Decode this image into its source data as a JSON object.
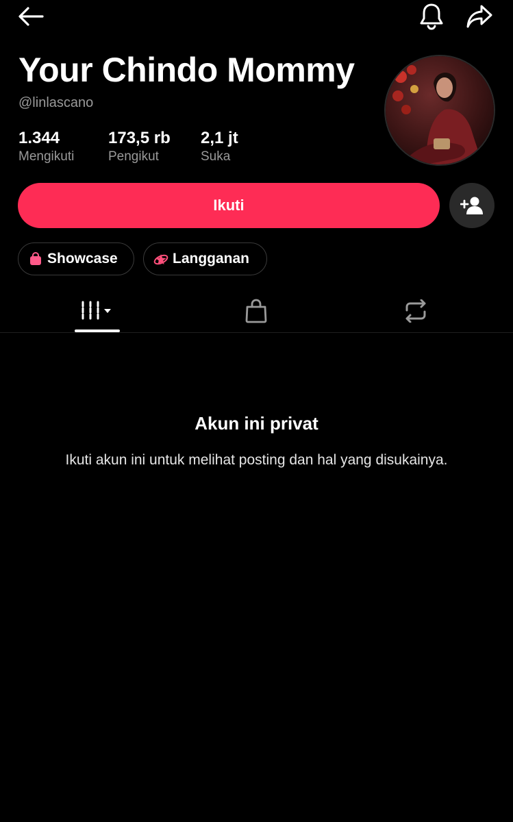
{
  "header": {
    "back_icon": "arrow-left-icon",
    "notification_icon": "bell-icon",
    "share_icon": "share-arrow-icon"
  },
  "profile": {
    "display_name": "Your Chindo Mommy",
    "username": "@linlascano",
    "stats": [
      {
        "value": "1.344",
        "label": "Mengikuti"
      },
      {
        "value": "173,5 rb",
        "label": "Pengikut"
      },
      {
        "value": "2,1 jt",
        "label": "Suka"
      }
    ]
  },
  "actions": {
    "follow_label": "Ikuti",
    "add_friend_icon": "person-add-icon",
    "follow_color": "#fe2c55"
  },
  "chips": [
    {
      "label": "Showcase",
      "icon": "shopping-bag-icon",
      "icon_color": "#ff5a8a"
    },
    {
      "label": "Langganan",
      "icon": "subscription-star-icon",
      "icon_color": "#ff4f7b"
    }
  ],
  "tabs": [
    {
      "icon": "videos-grid-dropdown-icon",
      "active": true
    },
    {
      "icon": "shopping-bag-outline-icon",
      "active": false
    },
    {
      "icon": "repost-icon",
      "active": false
    }
  ],
  "private_notice": {
    "title": "Akun ini privat",
    "description": "Ikuti akun ini untuk melihat posting dan hal yang disukainya."
  }
}
